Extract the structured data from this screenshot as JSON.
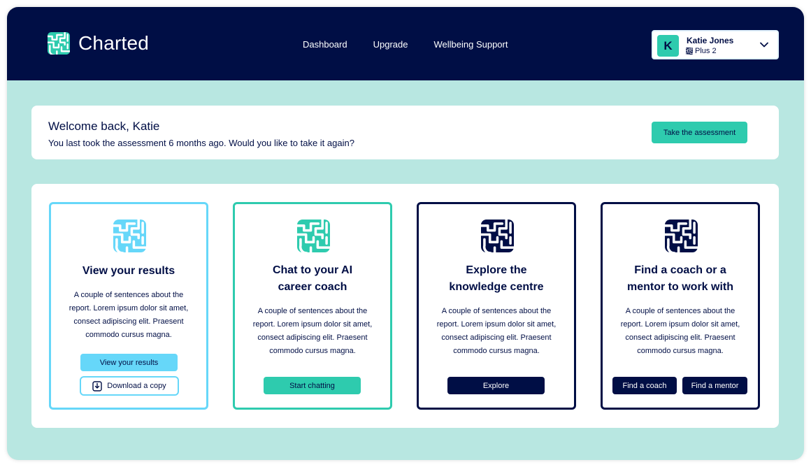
{
  "colors": {
    "navy": "#000e45",
    "teal": "#2ecbae",
    "light_blue": "#66d7f9",
    "mint_bg": "#b8e7e1"
  },
  "header": {
    "brand_name": "Charted",
    "brand_icon": "charted-maze-logo-icon",
    "nav": [
      "Dashboard",
      "Upgrade",
      "Wellbeing Support"
    ],
    "user": {
      "initial": "K",
      "name": "Katie Jones",
      "plan": "Plus 2",
      "plan_icon": "maze-icon",
      "menu_icon": "chevron-down-icon"
    }
  },
  "welcome": {
    "title": "Welcome back, Katie",
    "subtitle": "You last took the assessment 6 months ago. Would you like to take it again?",
    "button": "Take the assessment"
  },
  "cards": [
    {
      "title_lines": [
        "View your results"
      ],
      "icon": "maze-icon",
      "accent": "#66d7f9",
      "desc_lines": [
        "A couple of sentences about the",
        "report. Lorem ipsum dolor sit amet,",
        "consect adipiscing elit. Praesent",
        "commodo cursus magna."
      ],
      "buttons": [
        "View your results",
        "Download a copy"
      ]
    },
    {
      "title_lines": [
        "Chat to your AI",
        "career coach"
      ],
      "icon": "maze-icon",
      "accent": "#2ecbae",
      "desc_lines": [
        "A couple of sentences about the",
        "report. Lorem ipsum dolor sit amet,",
        "consect adipiscing elit. Praesent",
        "commodo cursus magna."
      ],
      "buttons": [
        "Start chatting"
      ]
    },
    {
      "title_lines": [
        "Explore the",
        "knowledge centre"
      ],
      "icon": "maze-icon",
      "accent": "#000e45",
      "desc_lines": [
        "A couple of sentences about the",
        "report. Lorem ipsum dolor sit amet,",
        "consect adipiscing elit. Praesent",
        "commodo cursus magna."
      ],
      "buttons": [
        "Explore"
      ]
    },
    {
      "title_lines": [
        "Find a coach or a",
        "mentor to work with"
      ],
      "icon": "maze-icon",
      "accent": "#000e45",
      "desc_lines": [
        "A couple of sentences about the",
        "report. Lorem ipsum dolor sit amet,",
        "consect adipiscing elit. Praesent",
        "commodo cursus magna."
      ],
      "buttons": [
        "Find a coach",
        "Find a mentor"
      ]
    }
  ]
}
